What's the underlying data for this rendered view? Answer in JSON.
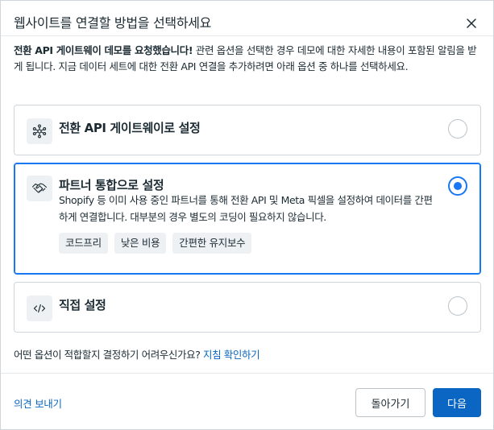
{
  "dialog": {
    "title": "웹사이트를 연결할 방법을 선택하세요",
    "close_icon": "close-icon"
  },
  "intro": {
    "bold": "전환 API 게이트웨이 데모를 요청했습니다!",
    "text": " 관련 옵션을 선택한 경우 데모에 대한 자세한 내용이 포함된 알림을 받게 됩니다. 지금 데이터 세트에 대한 전환 API 연결을 추가하려면 아래 옵션 중 하나를 선택하세요."
  },
  "options": [
    {
      "title": "전환 API 게이트웨이로 설정",
      "icon": "network-nodes-icon",
      "selected": false
    },
    {
      "title": "파트너 통합으로 설정",
      "icon": "handshake-icon",
      "description": "Shopify 등 이미 사용 중인 파트너를 통해 전환 API 및 Meta 픽셀을 설정하여 데이터를 간편하게 연결합니다. 대부분의 경우 별도의 코딩이 필요하지 않습니다.",
      "tags": [
        "코드프리",
        "낮은 비용",
        "간편한 유지보수"
      ],
      "selected": true
    },
    {
      "title": "직접 설정",
      "icon": "code-icon",
      "selected": false
    }
  ],
  "help": {
    "text": "어떤 옵션이 적합할지 결정하기 어려우신가요?",
    "link": "지침 확인하기"
  },
  "footer": {
    "feedback": "의견 보내기",
    "back_label": "돌아가기",
    "next_label": "다음"
  },
  "colors": {
    "accent": "#1877f2",
    "button_primary": "#0a66c2",
    "link": "#0a66c2"
  }
}
